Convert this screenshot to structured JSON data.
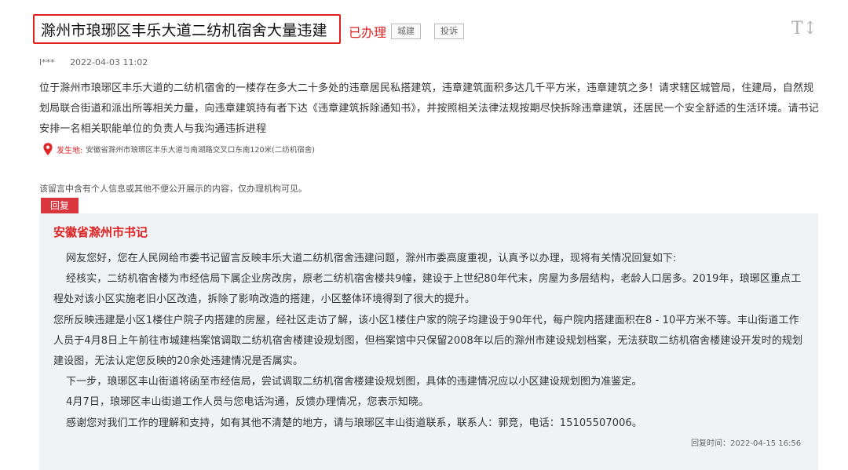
{
  "post": {
    "title": "滁州市琅琊区丰乐大道二纺机宿舍大量违建",
    "status": "已办理",
    "category_tag": "城建",
    "complaint_tag": "投诉",
    "author": "l***",
    "date": "2022-04-03 11:02",
    "description": "位于滁州市琅琊区丰乐大道的二纺机宿舍的一楼存在多大二十多处的违章居民私搭建筑，违章建筑面积多达几千平方米，违章建筑之多！请求辖区城管局，住建局，自然规划局联合街道和派出所等相关力量，向违章建筑持有者下达《违章建筑拆除通知书》，并按照相关法律法规按期尽快拆除违章建筑，还居民一个安全舒适的生活环境。请书记安排一名相关职能单位的负责人与我沟通违拆进程",
    "location_label": "发生地:",
    "location": "安徽省滁州市琅琊区丰乐大道与南湖路交叉口东南120米(二纺机宿舍)",
    "privacy_note": "该留言中含有个人信息或其他不便公开展示的内容，仅办理机构可见。",
    "font_size_icon": "T↕"
  },
  "reply": {
    "tab_label": "回复",
    "org": "安徽省滁州市书记",
    "paragraphs": [
      "网友您好，您在人民网给市委书记留言反映丰乐大道二纺机宿舍违建问题，滁州市委高度重视，认真予以办理，现将有关情况回复如下:",
      "经核实，二纺机宿舍楼为市经信局下属企业房改房，原老二纺机宿舍楼共9幢，建设于上世纪80年代末，房屋为多层结构，老龄人口居多。2019年，琅琊区重点工程处对该小区实施老旧小区改造，拆除了影响改造的搭建，小区整体环境得到了很大的提升。",
      "您所反映违建是小区1楼住户院子内搭建的房屋，经社区走访了解，该小区1楼住户家的院子均建设于90年代，每户院内搭建面积在8 - 10平方米不等。丰山街道工作人员于4月8日上午前往市城建档案馆调取二纺机宿舍楼建设规划图，但档案馆中只保留2008年以后的滁州市建设规划档案，无法获取二纺机宿舍楼建设开发时的规划建设图，无法认定您反映的20余处违建情况是否属实。",
      "下一步，琅琊区丰山街道将函至市经信局，尝试调取二纺机宿舍楼建设规划图，具体的违建情况应以小区建设规划图为准鉴定。",
      "4月7日，琅琊区丰山街道工作人员与您电话沟通，反馈办理情况，您表示知晓。",
      "感谢您对我们工作的理解和支持，如有其他不清楚的地方，请与琅琊区丰山街道联系，联系人：郭竞，电话：15105507006。"
    ],
    "time": "回复时间：2022-04-15 16:56"
  },
  "colors": {
    "accent": "#d9363e",
    "panel_bg": "#f1f2f6",
    "highlight_border": "#e02020"
  },
  "icons": {
    "location": "map-pin-icon",
    "font_size": "font-size-icon"
  }
}
